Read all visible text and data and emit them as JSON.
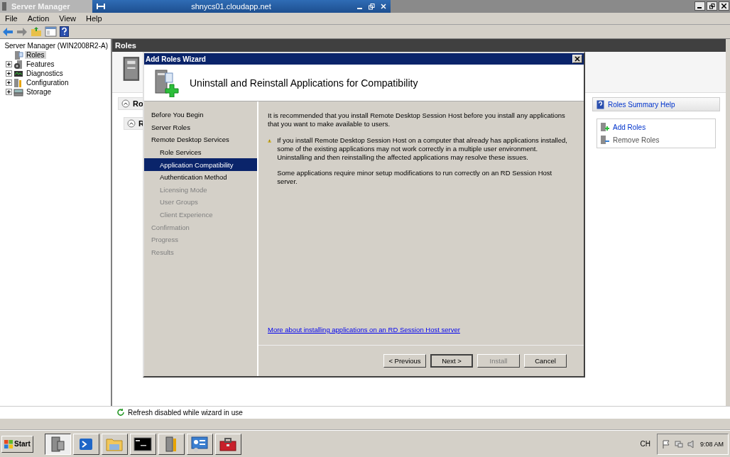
{
  "remote_bar": {
    "title": "shnycs01.cloudapp.net"
  },
  "window": {
    "title": "Server Manager"
  },
  "menu": [
    "File",
    "Action",
    "View",
    "Help"
  ],
  "tree": {
    "root": "Server Manager (WIN2008R2-A)",
    "children": [
      {
        "label": "Roles",
        "kind": "roles",
        "selected": true,
        "expandable": false
      },
      {
        "label": "Features",
        "kind": "features",
        "selected": false,
        "expandable": true
      },
      {
        "label": "Diagnostics",
        "kind": "diagnostics",
        "selected": false,
        "expandable": true
      },
      {
        "label": "Configuration",
        "kind": "configuration",
        "selected": false,
        "expandable": true
      },
      {
        "label": "Storage",
        "kind": "storage",
        "selected": false,
        "expandable": true
      }
    ]
  },
  "pane": {
    "title": "Roles",
    "sections": [
      "Ro",
      "R"
    ],
    "help_link": "Roles Summary Help",
    "actions": [
      {
        "label": "Add Roles",
        "kind": "add",
        "disabled": false
      },
      {
        "label": "Remove Roles",
        "kind": "remove",
        "disabled": true
      }
    ]
  },
  "status": "Refresh disabled while wizard in use",
  "wizard": {
    "title": "Add Roles Wizard",
    "heading": "Uninstall and Reinstall Applications for Compatibility",
    "steps": [
      {
        "label": "Before You Begin",
        "selected": false,
        "disabled": false
      },
      {
        "label": "Server Roles",
        "selected": false,
        "disabled": false
      },
      {
        "label": "Remote Desktop Services",
        "selected": false,
        "disabled": false,
        "children": [
          {
            "label": "Role Services",
            "selected": false,
            "disabled": false
          },
          {
            "label": "Application Compatibility",
            "selected": true,
            "disabled": false
          },
          {
            "label": "Authentication Method",
            "selected": false,
            "disabled": false
          },
          {
            "label": "Licensing Mode",
            "selected": false,
            "disabled": true
          },
          {
            "label": "User Groups",
            "selected": false,
            "disabled": true
          },
          {
            "label": "Client Experience",
            "selected": false,
            "disabled": true
          }
        ]
      },
      {
        "label": "Confirmation",
        "selected": false,
        "disabled": true
      },
      {
        "label": "Progress",
        "selected": false,
        "disabled": true
      },
      {
        "label": "Results",
        "selected": false,
        "disabled": true
      }
    ],
    "intro": "It is recommended that you install Remote Desktop Session Host before you install any applications that you want to make available to users.",
    "warning": "If you install Remote Desktop Session Host on a computer that already has applications installed, some of the existing applications may not work correctly in a multiple user environment. Uninstalling and then reinstalling the affected applications may resolve these issues.",
    "note": "Some applications require minor setup modifications to run correctly on an RD Session Host server.",
    "link": "More about installing applications on an RD Session Host server",
    "buttons": [
      {
        "label": "< Previous",
        "disabled": false,
        "default": false
      },
      {
        "label": "Next >",
        "disabled": false,
        "default": true
      },
      {
        "label": "Install",
        "disabled": true,
        "default": false
      },
      {
        "label": "Cancel",
        "disabled": false,
        "default": false
      }
    ]
  },
  "taskbar": {
    "start": "Start",
    "apps": [
      {
        "kind": "server",
        "active": true
      },
      {
        "kind": "powershell",
        "active": false
      },
      {
        "kind": "folder",
        "active": false
      },
      {
        "kind": "console",
        "active": false
      },
      {
        "kind": "tools",
        "active": false
      },
      {
        "kind": "panel",
        "active": false
      },
      {
        "kind": "toolbox",
        "active": false
      }
    ],
    "language": "CH",
    "time": "9:08 AM"
  }
}
